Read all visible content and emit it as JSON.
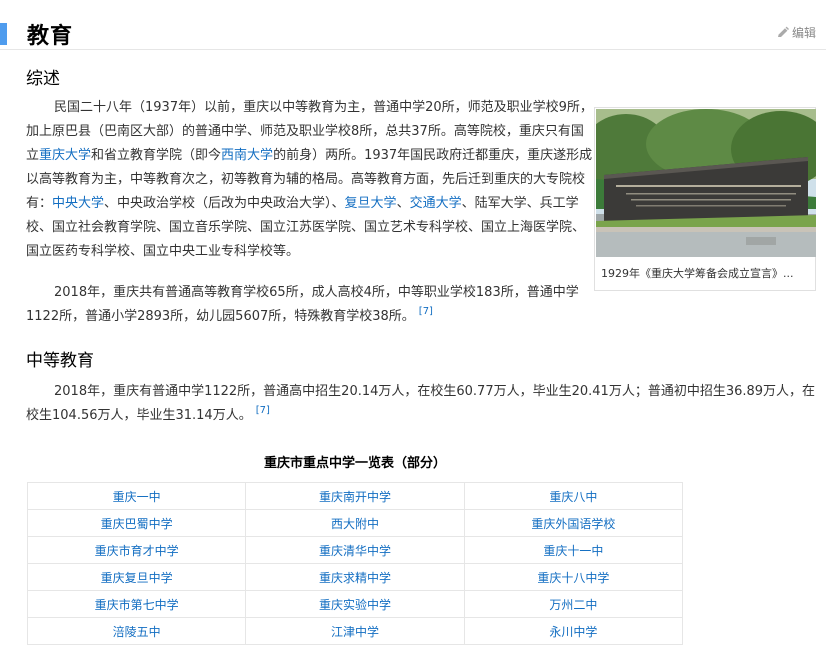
{
  "section_title": "教育",
  "edit_label": "编辑",
  "overview": {
    "heading": "综述",
    "p1": [
      {
        "t": "民国二十八年（1937年）以前，重庆以中等教育为主，普通中学20所，师范及职业学校9所，加上原巴县（巴南区大部）的普通中学、师范及职业学校8所，总共37所。高等院校，重庆只有国立"
      },
      {
        "t": "重庆大学",
        "link": true
      },
      {
        "t": "和省立教育学院（即今"
      },
      {
        "t": "西南大学",
        "link": true
      },
      {
        "t": "的前身）两所。1937年国民政府迁都重庆，重庆遂形成以高等教育为主，中等教育次之，初等教育为辅的格局。高等教育方面，先后迁到重庆的大专院校有："
      },
      {
        "t": "中央大学",
        "link": true
      },
      {
        "t": "、中央政治学校（后改为中央政治大学）、"
      },
      {
        "t": "复旦大学",
        "link": true
      },
      {
        "t": "、"
      },
      {
        "t": "交通大学",
        "link": true
      },
      {
        "t": "、陆军大学、兵工学校、国立社会教育学院、国立音乐学院、国立江苏医学院、国立艺术专科学校、国立上海医学院、国立医药专科学校、国立中央工业专科学校等。"
      }
    ],
    "p2": "2018年，重庆共有普通高等教育学校65所，成人高校4所，中等职业学校183所，普通中学1122所，普通小学2893所，幼儿园5607所，特殊教育学校38所。",
    "p2_ref": "[7]",
    "figure_caption": "1929年《重庆大学筹备会成立宣言》...",
    "figure_sign_text": "研究学术  造就人才  佑启乡邦  振导社会"
  },
  "secondary": {
    "heading": "中等教育",
    "p3": "2018年，重庆有普通中学1122所，普通高中招生20.14万人，在校生60.77万人，毕业生20.41万人；普通初中招生36.89万人，在校生104.56万人，毕业生31.14万人。",
    "p3_ref": "[7]",
    "table_title": "重庆市重点中学一览表（部分）",
    "schools": [
      [
        "重庆一中",
        "重庆南开中学",
        "重庆八中"
      ],
      [
        "重庆巴蜀中学",
        "西大附中",
        "重庆外国语学校"
      ],
      [
        "重庆市育才中学",
        "重庆清华中学",
        "重庆十一中"
      ],
      [
        "重庆复旦中学",
        "重庆求精中学",
        "重庆十八中学"
      ],
      [
        "重庆市第七中学",
        "重庆实验中学",
        "万州二中"
      ],
      [
        "涪陵五中",
        "江津中学",
        "永川中学"
      ]
    ]
  },
  "colors": {
    "accent_bar": "#4f9cee",
    "link": "#136ec2"
  },
  "icons": {
    "edit": "pencil-icon"
  }
}
